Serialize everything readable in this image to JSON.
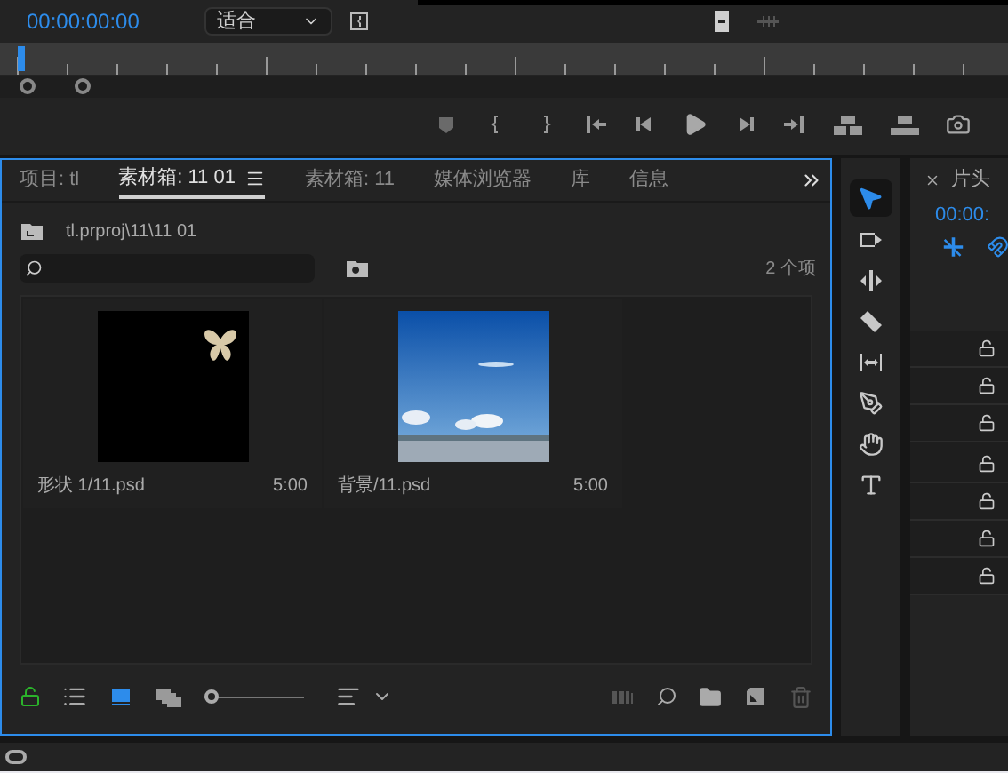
{
  "monitor": {
    "timecode": "00:00:00:00",
    "zoom_select": {
      "value": "适合"
    }
  },
  "project_panel": {
    "tabs": [
      {
        "label": "项目: tl",
        "selected": false
      },
      {
        "label": "素材箱: 11 01",
        "selected": true
      },
      {
        "label": "素材箱: 11",
        "selected": false
      },
      {
        "label": "媒体浏览器",
        "selected": false
      },
      {
        "label": "库",
        "selected": false
      },
      {
        "label": "信息",
        "selected": false
      }
    ],
    "path": "tl.prproj\\11\\11 01",
    "item_count": "2 个项",
    "zoom_slider": {
      "level": 0
    },
    "items": [
      {
        "kind": "shape",
        "name": "形状 1/11.psd",
        "duration": "5:00"
      },
      {
        "kind": "picture",
        "name": "背景/11.psd",
        "duration": "5:00"
      }
    ]
  },
  "tools": [
    {
      "kind": "select",
      "selected": true
    },
    {
      "kind": "track",
      "selected": false
    },
    {
      "kind": "ripple",
      "selected": false
    },
    {
      "kind": "razor",
      "selected": false
    },
    {
      "kind": "slip",
      "selected": false
    },
    {
      "kind": "pen",
      "selected": false
    },
    {
      "kind": "hand",
      "selected": false
    },
    {
      "kind": "type",
      "selected": false
    }
  ],
  "timeline": {
    "tab": "片头",
    "timecode": "00:00:",
    "tracks": [
      {
        "locked": false
      },
      {
        "locked": false
      },
      {
        "locked": false
      },
      {
        "locked": false
      },
      {
        "locked": false
      },
      {
        "locked": false
      },
      {
        "locked": false
      }
    ]
  }
}
